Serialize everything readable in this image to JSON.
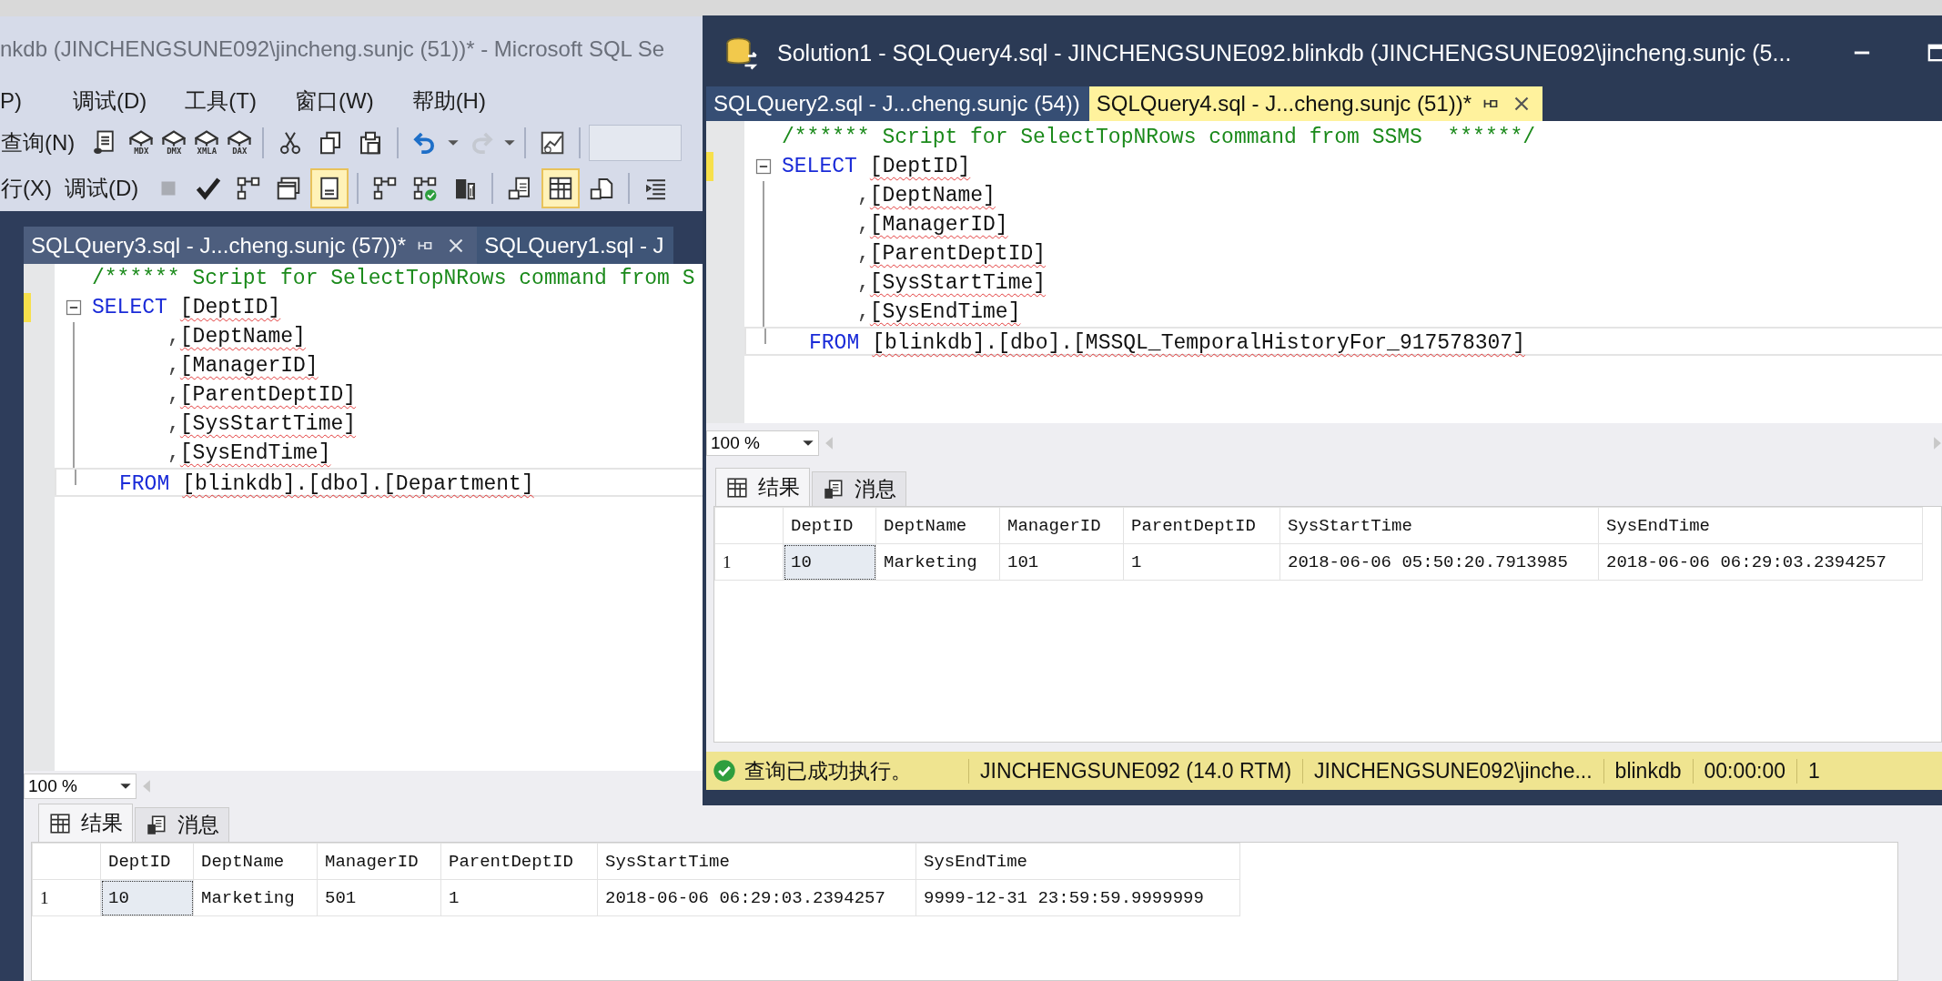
{
  "back_window": {
    "title": "nkdb (JINCHENGSUNE092\\jincheng.sunjc (51))* - Microsoft SQL Se",
    "menu": [
      "P)",
      "调试(D)",
      "工具(T)",
      "窗口(W)",
      "帮助(H)"
    ],
    "toolbar_1": [
      [
        {
          "kind": "text",
          "label": "查询(N)"
        },
        {
          "kind": "doc"
        },
        {
          "kind": "cube",
          "label": "MDX"
        },
        {
          "kind": "cube",
          "label": "DMX"
        },
        {
          "kind": "cube",
          "label": "XMLA"
        },
        {
          "kind": "cube",
          "label": "DAX"
        }
      ],
      [
        {
          "kind": "cut"
        },
        {
          "kind": "copy"
        },
        {
          "kind": "paste"
        }
      ],
      [
        {
          "kind": "undo"
        },
        {
          "kind": "caret"
        },
        {
          "kind": "redo"
        },
        {
          "kind": "caret"
        }
      ],
      [
        {
          "kind": "chart"
        }
      ],
      [
        {
          "kind": "field"
        }
      ]
    ],
    "toolbar_2": [
      [
        {
          "kind": "text",
          "label": "行(X)",
          "selected": false
        },
        {
          "kind": "text",
          "label": "调试(D)",
          "selected": false
        },
        {
          "kind": "stop",
          "selected": false
        },
        {
          "kind": "check",
          "selected": false
        },
        {
          "kind": "tree",
          "selected": false
        },
        {
          "kind": "window",
          "selected": false
        },
        {
          "kind": "form",
          "selected": true
        }
      ],
      [
        {
          "kind": "tree",
          "selected": false
        },
        {
          "kind": "tree-check",
          "selected": false
        },
        {
          "kind": "server",
          "selected": false
        }
      ],
      [
        {
          "kind": "text-file",
          "selected": false
        },
        {
          "kind": "grid",
          "selected": true
        },
        {
          "kind": "file-out",
          "selected": false
        }
      ],
      [
        {
          "kind": "indent",
          "selected": false
        }
      ]
    ],
    "tabs": [
      {
        "label": "SQLQuery3.sql - J...cheng.sunjc (57))*",
        "selected": true
      },
      {
        "label": "SQLQuery1.sql - J",
        "selected": false
      }
    ],
    "editor": [
      {
        "kind": "comment",
        "text": "/****** Script for SelectTopNRows command from S",
        "changed": false,
        "current": false
      },
      {
        "kind": "clause",
        "keyword": "SELECT",
        "text": "[DeptID]",
        "changed": true,
        "current": false
      },
      {
        "kind": "continuation",
        "comma": ",",
        "text": "[DeptName]",
        "changed": false,
        "current": false
      },
      {
        "kind": "continuation",
        "comma": ",",
        "text": "[ManagerID]",
        "changed": false,
        "current": false
      },
      {
        "kind": "continuation",
        "comma": ",",
        "text": "[ParentDeptID]",
        "changed": false,
        "current": false
      },
      {
        "kind": "continuation",
        "comma": ",",
        "text": "[SysStartTime]",
        "changed": false,
        "current": false
      },
      {
        "kind": "continuation",
        "comma": ",",
        "text": "[SysEndTime]",
        "changed": false,
        "current": false
      },
      {
        "kind": "clause",
        "keyword": "FROM",
        "text": "[blinkdb].[dbo].[Department]",
        "changed": false,
        "current": true
      }
    ],
    "zoom": "100 %",
    "result_tabs": [
      {
        "label": "结果",
        "kind": "grid",
        "selected": true
      },
      {
        "label": "消息",
        "kind": "messages",
        "selected": false
      }
    ],
    "grid": {
      "columns": [
        "DeptID",
        "DeptName",
        "ManagerID",
        "ParentDeptID",
        "SysStartTime",
        "SysEndTime"
      ],
      "rows": [
        {
          "number": "1",
          "cells": [
            {
              "text": "10",
              "selected": true
            },
            {
              "text": "Marketing",
              "selected": false
            },
            {
              "text": "501",
              "selected": false
            },
            {
              "text": "1",
              "selected": false
            },
            {
              "text": "2018-06-06 06:29:03.2394257",
              "selected": false
            },
            {
              "text": "9999-12-31 23:59:59.9999999",
              "selected": false
            }
          ]
        }
      ]
    }
  },
  "front_window": {
    "title": "Solution1 - SQLQuery4.sql - JINCHENGSUNE092.blinkdb (JINCHENGSUNE092\\jincheng.sunjc (5...",
    "tabs": [
      {
        "label": "SQLQuery2.sql - J...cheng.sunjc (54))",
        "selected": false
      },
      {
        "label": "SQLQuery4.sql - J...cheng.sunjc (51))*",
        "selected": true
      }
    ],
    "editor": [
      {
        "kind": "comment",
        "text": "/****** Script for SelectTopNRows command from SSMS  ******/",
        "changed": false,
        "current": false
      },
      {
        "kind": "clause",
        "keyword": "SELECT",
        "text": "[DeptID]",
        "changed": true,
        "current": false
      },
      {
        "kind": "continuation",
        "comma": ",",
        "text": "[DeptName]",
        "changed": false,
        "current": false
      },
      {
        "kind": "continuation",
        "comma": ",",
        "text": "[ManagerID]",
        "changed": false,
        "current": false
      },
      {
        "kind": "continuation",
        "comma": ",",
        "text": "[ParentDeptID]",
        "changed": false,
        "current": false
      },
      {
        "kind": "continuation",
        "comma": ",",
        "text": "[SysStartTime]",
        "changed": false,
        "current": false
      },
      {
        "kind": "continuation",
        "comma": ",",
        "text": "[SysEndTime]",
        "changed": false,
        "current": false
      },
      {
        "kind": "clause",
        "keyword": "FROM",
        "text": "[blinkdb].[dbo].[MSSQL_TemporalHistoryFor_917578307]",
        "changed": false,
        "current": true
      }
    ],
    "zoom": "100 %",
    "result_tabs": [
      {
        "label": "结果",
        "kind": "grid",
        "selected": true
      },
      {
        "label": "消息",
        "kind": "messages",
        "selected": false
      }
    ],
    "grid": {
      "columns": [
        "DeptID",
        "DeptName",
        "ManagerID",
        "ParentDeptID",
        "SysStartTime",
        "SysEndTime"
      ],
      "rows": [
        {
          "number": "1",
          "cells": [
            {
              "text": "10",
              "selected": true
            },
            {
              "text": "Marketing",
              "selected": false
            },
            {
              "text": "101",
              "selected": false
            },
            {
              "text": "1",
              "selected": false
            },
            {
              "text": "2018-06-06 05:50:20.7913985",
              "selected": false
            },
            {
              "text": "2018-06-06 06:29:03.2394257",
              "selected": false
            }
          ]
        }
      ]
    },
    "status_bar": {
      "message": "查询已成功执行。",
      "server": "JINCHENGSUNE092 (14.0 RTM)",
      "user": "JINCHENGSUNE092\\jinche...",
      "database": "blinkdb",
      "elapsed": "00:00:00",
      "rows": "1"
    }
  }
}
